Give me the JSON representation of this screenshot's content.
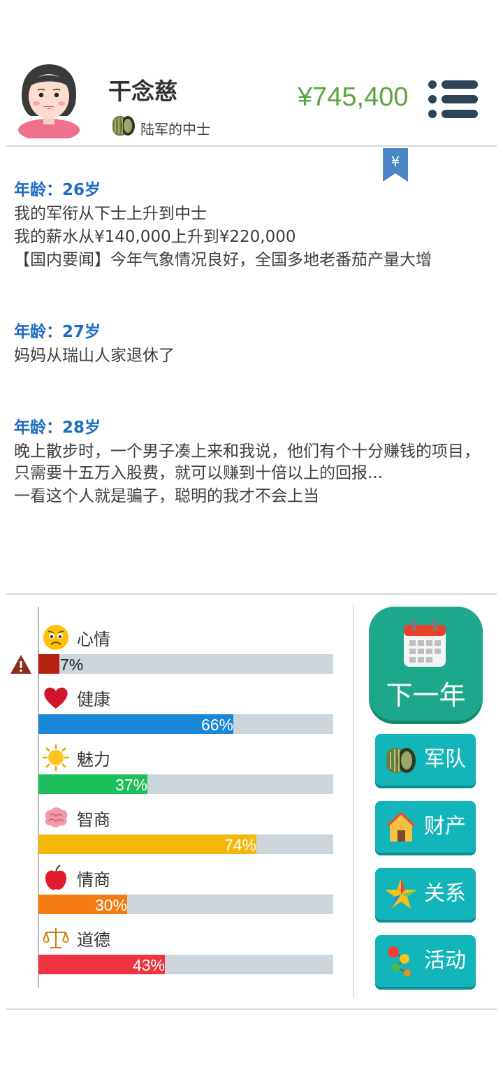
{
  "profile": {
    "name": "干念慈",
    "rank": "陆军的中士",
    "money": "¥745,400"
  },
  "events": [
    {
      "age": "年龄：26岁",
      "lines": [
        "我的军衔从下士上升到中士",
        "我的薪水从¥140,000上升到¥220,000",
        "【国内要闻】今年气象情况良好，全国多地老番茄产量大增"
      ]
    },
    {
      "age": "年龄：27岁",
      "lines": [
        "妈妈从瑞山人家退休了"
      ]
    },
    {
      "age": "年龄：28岁",
      "lines": [
        "晚上散步时，一个男子凑上来和我说，他们有个十分赚钱的项目，只需要十五万入股费，就可以赚到十倍以上的回报...",
        "一看这个人就是骗子，聪明的我才不会上当"
      ]
    }
  ],
  "stats": [
    {
      "label": "心情",
      "value": 7,
      "pct": "7%",
      "color": "#b5210f",
      "icon": "sad-face-icon"
    },
    {
      "label": "健康",
      "value": 66,
      "pct": "66%",
      "color": "#1b87d8",
      "icon": "heart-icon"
    },
    {
      "label": "魅力",
      "value": 37,
      "pct": "37%",
      "color": "#1cbf59",
      "icon": "sun-icon"
    },
    {
      "label": "智商",
      "value": 74,
      "pct": "74%",
      "color": "#f5b70a",
      "icon": "brain-icon"
    },
    {
      "label": "情商",
      "value": 30,
      "pct": "30%",
      "color": "#f57c12",
      "icon": "apple-icon"
    },
    {
      "label": "道德",
      "value": 43,
      "pct": "43%",
      "color": "#ef3340",
      "icon": "scales-icon"
    }
  ],
  "actions": {
    "next_year": "下一年",
    "army": "军队",
    "property": "财产",
    "relations": "关系",
    "activities": "活动"
  },
  "colors": {
    "money": "#5aa53f",
    "age_heading": "#1f6cc4",
    "next_year_bg": "#1ea88b",
    "side_button_bg": "#12b5ba"
  }
}
